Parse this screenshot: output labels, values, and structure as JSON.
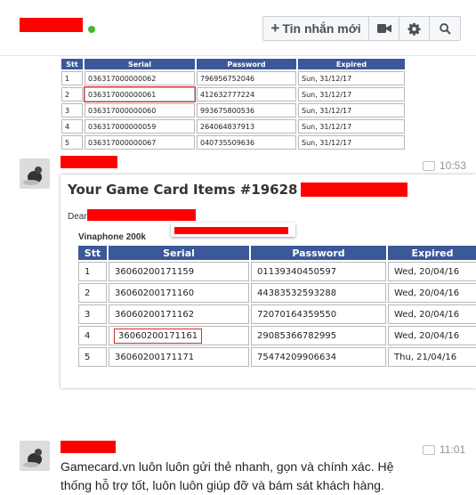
{
  "header": {
    "new_message_label": "Tin nhắn mới",
    "icons": [
      "plus-icon",
      "video-camera-icon",
      "gear-icon",
      "search-icon"
    ]
  },
  "top_table": {
    "columns": [
      "Stt",
      "Serial",
      "Password",
      "Expired"
    ],
    "rows": [
      [
        "1",
        "036317000000062",
        "796956752046",
        "Sun, 31/12/17"
      ],
      [
        "2",
        "036317000000061",
        "412632777224",
        "Sun, 31/12/17"
      ],
      [
        "3",
        "036317000000060",
        "993675800536",
        "Sun, 31/12/17"
      ],
      [
        "4",
        "036317000000059",
        "264064837913",
        "Sun, 31/12/17"
      ],
      [
        "5",
        "036317000000067",
        "040735509636",
        "Sun, 31/12/17"
      ]
    ]
  },
  "message1": {
    "time": "10:53",
    "email_title": "Your Game Card Items #19628 &",
    "dear": "Dear",
    "product": "Vinaphone 200k",
    "table": {
      "columns": [
        "Stt",
        "Serial",
        "Password",
        "Expired"
      ],
      "rows": [
        [
          "1",
          "36060200171159",
          "01139340450597",
          "Wed, 20/04/16"
        ],
        [
          "2",
          "36060200171160",
          "44383532593288",
          "Wed, 20/04/16"
        ],
        [
          "3",
          "36060200171162",
          "72070164359550",
          "Wed, 20/04/16"
        ],
        [
          "4",
          "36060200171161",
          "29085366782995",
          "Wed, 20/04/16"
        ],
        [
          "5",
          "36060200171171",
          "75474209906634",
          "Thu, 21/04/16"
        ]
      ]
    }
  },
  "message2": {
    "time": "11:01",
    "text": "Gamecard.vn luôn luôn gửi thẻ nhanh, gọn và chính xác. Hệ thống hỗ trợ tốt, luôn luôn giúp đỡ và bám sát khách hàng."
  },
  "colors": {
    "table_header": "#3b5998",
    "redaction": "#ff0000",
    "online": "#42b72a"
  }
}
